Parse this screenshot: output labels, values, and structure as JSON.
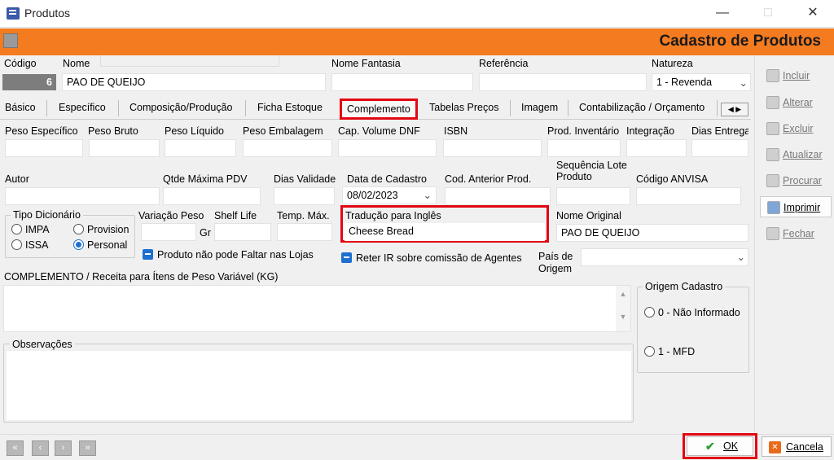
{
  "window": {
    "title": "Produtos",
    "header": "Cadastro de Produtos"
  },
  "top": {
    "codigo_label": "Código",
    "codigo_value": "6",
    "nome_label": "Nome",
    "nome_value": "PAO DE QUEIJO",
    "fantasia_label": "Nome Fantasia",
    "fantasia_value": "",
    "referencia_label": "Referência",
    "referencia_value": "",
    "natureza_label": "Natureza",
    "natureza_value": "1 - Revenda"
  },
  "tabs": [
    "Básico",
    "Específico",
    "Composição/Produção",
    "Ficha Estoque",
    "Complemento",
    "Tabelas Preços",
    "Imagem",
    "Contabilização / Orçamento"
  ],
  "row1": {
    "labels": [
      "Peso Específico",
      "Peso Bruto",
      "Peso Líquido",
      "Peso Embalagem",
      "Cap. Volume DNF",
      "ISBN",
      "Prod. Inventário",
      "Integração",
      "Dias Entrega"
    ]
  },
  "row2": {
    "autor": "Autor",
    "qtde": "Qtde Máxima PDV",
    "dias_validade": "Dias Validade",
    "data_cadastro_label": "Data de Cadastro",
    "data_cadastro_value": "08/02/2023",
    "cod_anterior": "Cod. Anterior Prod.",
    "seq_lote": "Sequência Lote\nProduto",
    "anvisa": "Código ANVISA"
  },
  "tipo_dicionario": {
    "title": "Tipo Dicionário",
    "options": [
      "IMPA",
      "Provision",
      "ISSA",
      "Personal"
    ],
    "selected": "Personal"
  },
  "row3": {
    "variacao": "Variação Peso",
    "unit": "Gr",
    "shelf_life": "Shelf Life",
    "temp_max": "Temp. Máx.",
    "traducao_label": "Tradução para Inglês",
    "traducao_value": "Cheese Bread",
    "nome_original_label": "Nome Original",
    "nome_original_value": "PAO DE QUEIJO"
  },
  "checks": {
    "falta": "Produto não pode Faltar nas Lojas",
    "reter": "Reter IR sobre comissão de Agentes",
    "pais_label": "País de\nOrigem"
  },
  "complemento_label": "COMPLEMENTO / Receita para Ítens de Peso Variável (KG)",
  "observacoes_label": "Observações",
  "origem": {
    "title": "Origem Cadastro",
    "options": [
      "0 - Não Informado",
      "1 - MFD"
    ]
  },
  "side": [
    "Incluir",
    "Alterar",
    "Excluir",
    "Atualizar",
    "Procurar",
    "Imprimir",
    "Fechar"
  ],
  "bottom": {
    "ok": "OK",
    "cancel": "Cancela"
  },
  "colors": {
    "accent": "#f47b20",
    "highlight": "#e30613",
    "check": "#1e6fd0"
  }
}
